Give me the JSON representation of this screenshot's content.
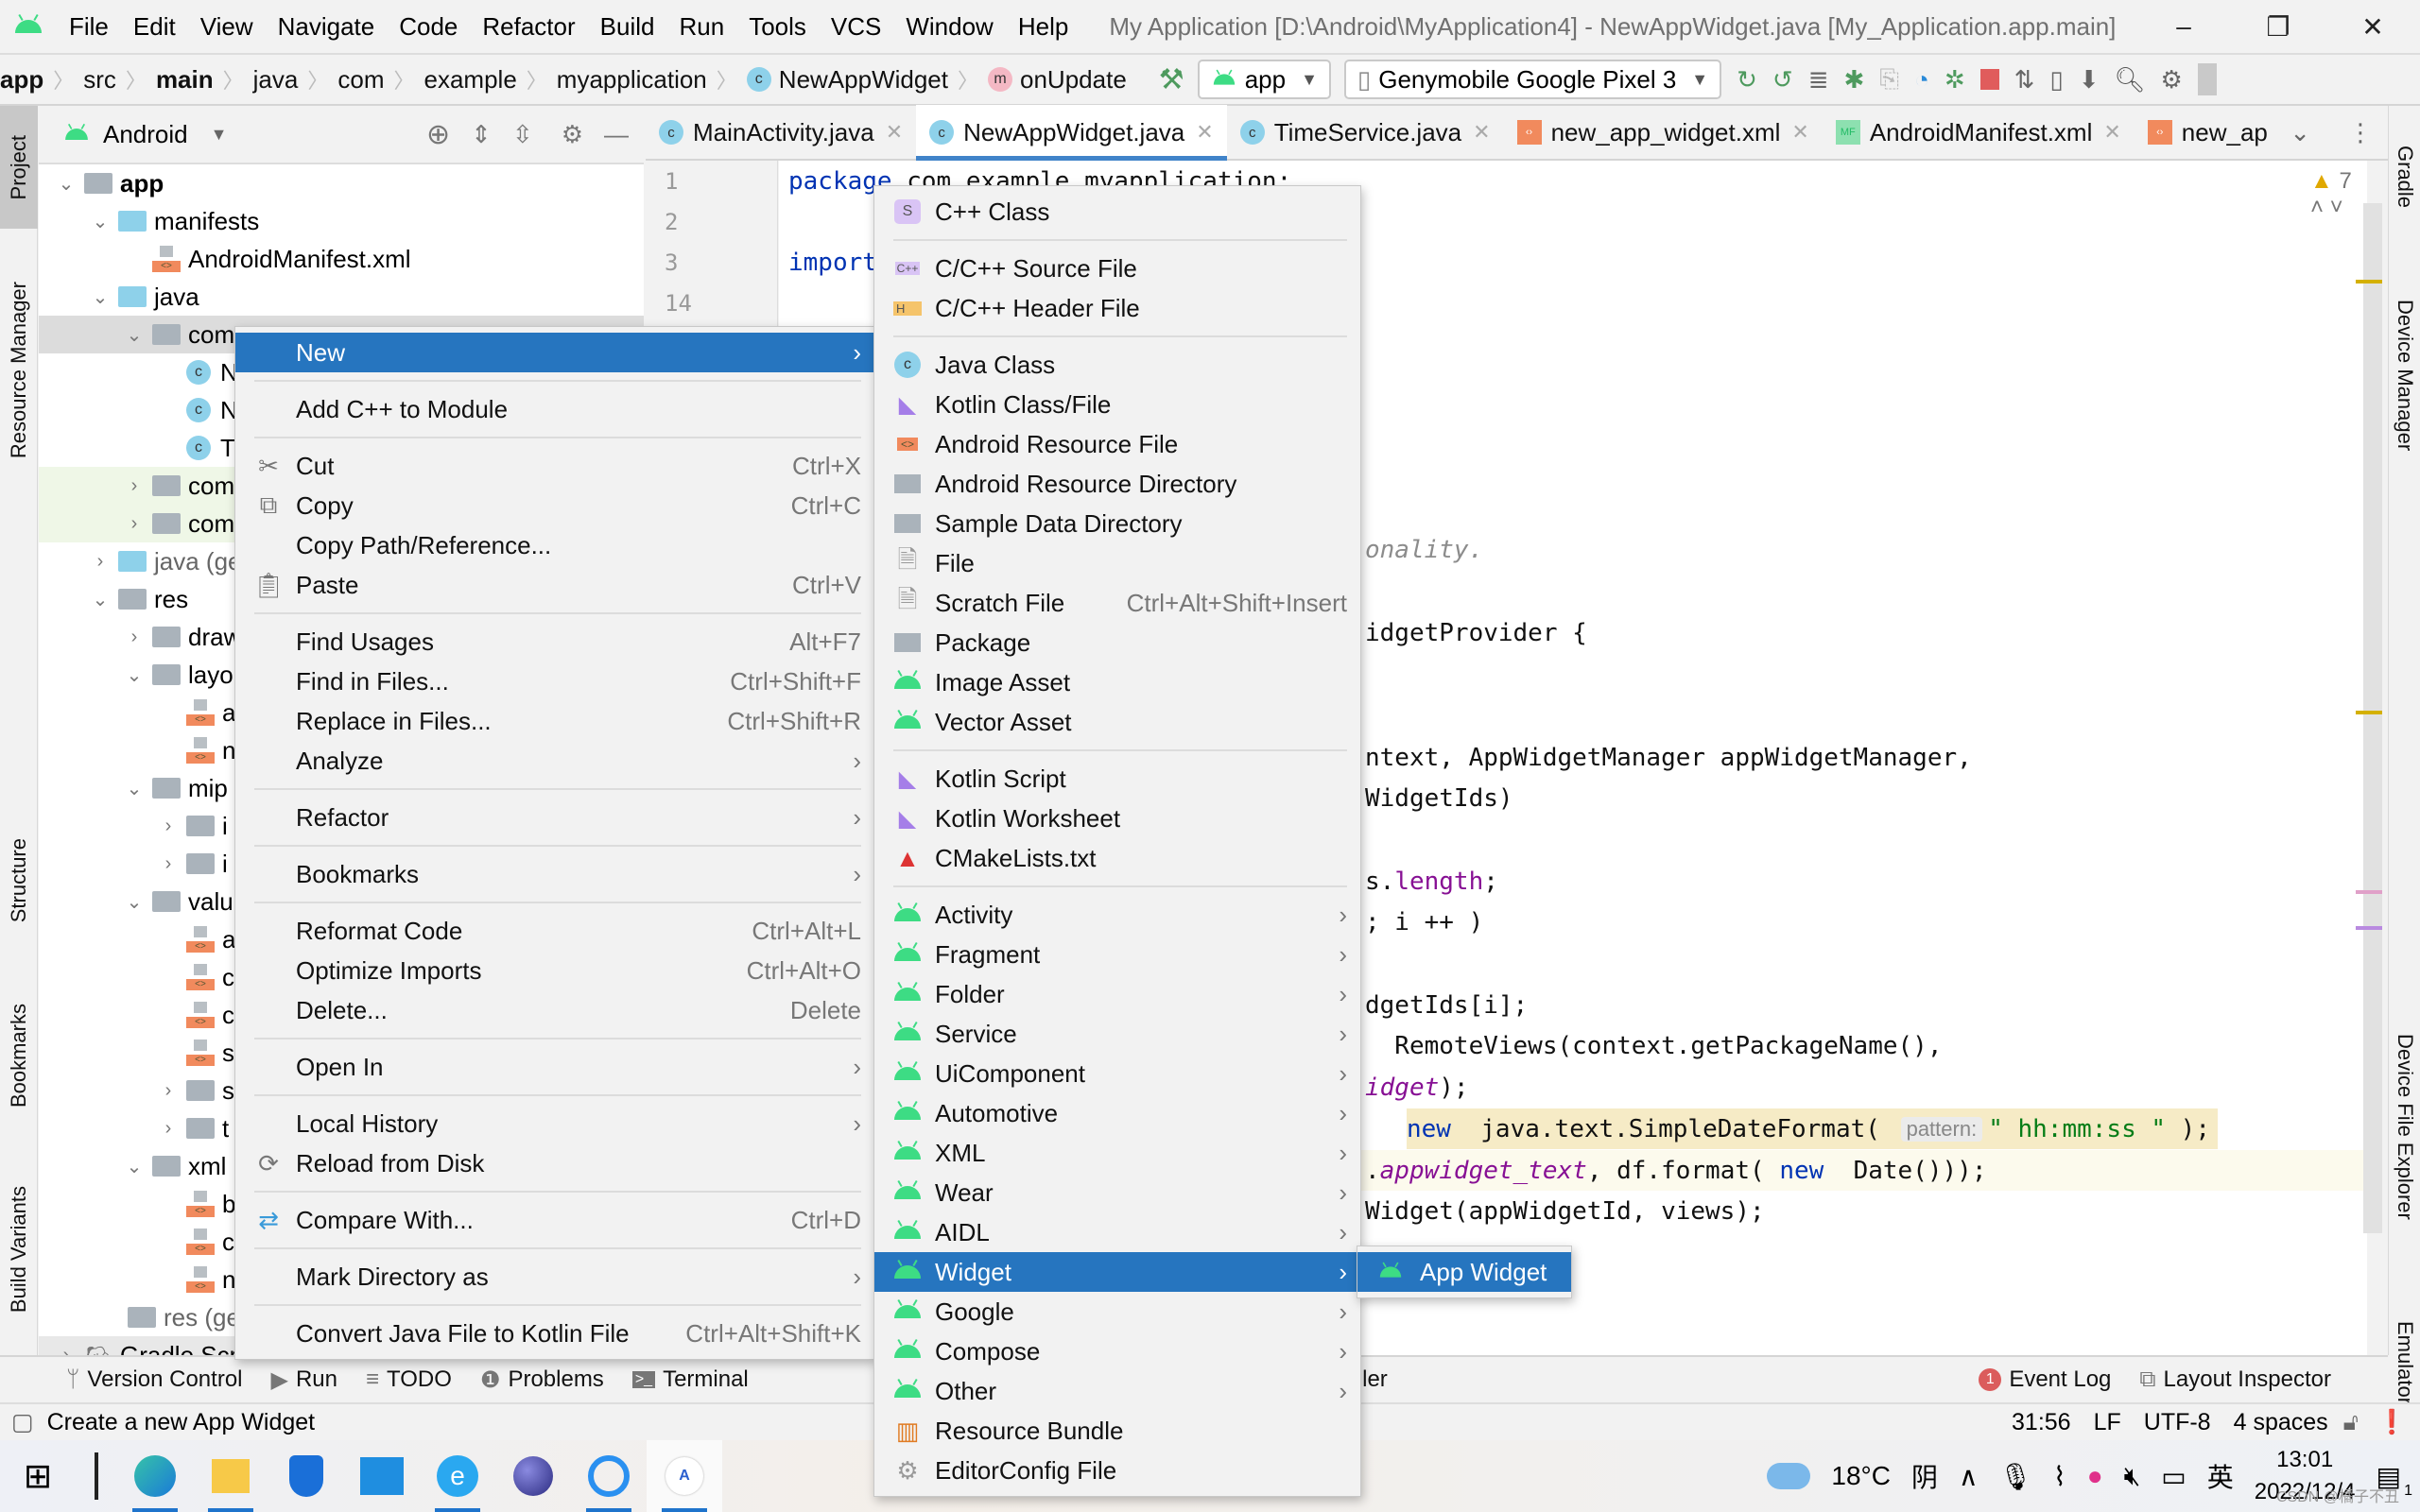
{
  "menubar": {
    "items": [
      "File",
      "Edit",
      "View",
      "Navigate",
      "Code",
      "Refactor",
      "Build",
      "Run",
      "Tools",
      "VCS",
      "Window",
      "Help"
    ],
    "title": "My Application [D:\\Android\\MyApplication4] - NewAppWidget.java [My_Application.app.main]",
    "minimize": "–",
    "restore": "❐",
    "close": "✕"
  },
  "breadcrumb": {
    "items": [
      "app",
      "src",
      "main",
      "java",
      "com",
      "example",
      "myapplication",
      "NewAppWidget",
      "onUpdate"
    ],
    "class_badge": "c",
    "method_badge": "m"
  },
  "toolbar": {
    "run_config": "app",
    "device": "Genymobile Google Pixel 3"
  },
  "left_tool_tabs": [
    "Project",
    "Resource Manager",
    "Structure",
    "Bookmarks",
    "Build Variants"
  ],
  "right_tool_tabs": [
    "Gradle",
    "Device Manager",
    "Device File Explorer",
    "Emulator"
  ],
  "project": {
    "view_selector": "Android",
    "tree": [
      {
        "label": "app",
        "bold": true
      },
      {
        "label": "manifests"
      },
      {
        "label": "AndroidManifest.xml"
      },
      {
        "label": "java"
      },
      {
        "label": "com"
      },
      {
        "label": "N"
      },
      {
        "label": "N"
      },
      {
        "label": "T"
      },
      {
        "label": "com"
      },
      {
        "label": "com"
      },
      {
        "label": "java (ge"
      },
      {
        "label": "res"
      },
      {
        "label": "draw"
      },
      {
        "label": "layo"
      },
      {
        "label": "a"
      },
      {
        "label": "n"
      },
      {
        "label": "mip"
      },
      {
        "label": "i"
      },
      {
        "label": "i"
      },
      {
        "label": "valu"
      },
      {
        "label": "a"
      },
      {
        "label": "c"
      },
      {
        "label": "c"
      },
      {
        "label": "s"
      },
      {
        "label": "s"
      },
      {
        "label": "t"
      },
      {
        "label": "xml"
      },
      {
        "label": "b"
      },
      {
        "label": "c"
      },
      {
        "label": "n"
      },
      {
        "label": "res (ge"
      },
      {
        "label": "Gradle Scr"
      }
    ]
  },
  "editor": {
    "tabs": [
      {
        "label": "MainActivity.java",
        "icon": "c"
      },
      {
        "label": "NewAppWidget.java",
        "icon": "c",
        "active": true
      },
      {
        "label": "TimeService.java",
        "icon": "c"
      },
      {
        "label": "new_app_widget.xml",
        "icon": "xml"
      },
      {
        "label": "AndroidManifest.xml",
        "icon": "mf"
      },
      {
        "label": "new_ap",
        "icon": "xml"
      }
    ],
    "warnings_count": "7",
    "line_numbers": [
      "1",
      "2",
      "3",
      "14"
    ],
    "code": {
      "l1_kw": "package",
      "l1_rest": " com.example.myapplication;",
      "l3_kw": "import",
      "comment": "onality.",
      "provider": "idgetProvider {",
      "params1": "ntext, AppWidgetManager appWidgetManager,",
      "params2": "WidgetIds)",
      "len_a": "s.",
      "len_b": "length",
      "len_c": ";",
      "loop": "; i ++ )",
      "ids": "dgetIds[i];",
      "remote": "  RemoteViews(context.getPackageName(),",
      "widget_a": "idget",
      "widget_b": ");",
      "sdf_new": "new",
      "sdf_mid": "  java.text.SimpleDateFormat( ",
      "sdf_hint": "pattern:",
      "sdf_str": "\" hh:mm:ss \"",
      "sdf_end": " );",
      "set_a": ".",
      "set_b": "appwidget_text",
      "set_c": ", df.format( ",
      "set_new": "new",
      "set_d": "  Date()));",
      "update": "Widget(appWidgetId, views);"
    }
  },
  "context_menu": {
    "groups": [
      [
        {
          "label": "New",
          "submenu": true,
          "highlighted": true
        }
      ],
      [
        {
          "label": "Add C++ to Module"
        }
      ],
      [
        {
          "label": "Cut",
          "shortcut": "Ctrl+X",
          "icon": "scissors"
        },
        {
          "label": "Copy",
          "shortcut": "Ctrl+C",
          "icon": "copy"
        },
        {
          "label": "Copy Path/Reference..."
        },
        {
          "label": "Paste",
          "shortcut": "Ctrl+V",
          "icon": "clipboard"
        }
      ],
      [
        {
          "label": "Find Usages",
          "shortcut": "Alt+F7"
        },
        {
          "label": "Find in Files...",
          "shortcut": "Ctrl+Shift+F"
        },
        {
          "label": "Replace in Files...",
          "shortcut": "Ctrl+Shift+R"
        },
        {
          "label": "Analyze",
          "submenu": true
        }
      ],
      [
        {
          "label": "Refactor",
          "submenu": true
        }
      ],
      [
        {
          "label": "Bookmarks",
          "submenu": true
        }
      ],
      [
        {
          "label": "Reformat Code",
          "shortcut": "Ctrl+Alt+L"
        },
        {
          "label": "Optimize Imports",
          "shortcut": "Ctrl+Alt+O"
        },
        {
          "label": "Delete...",
          "shortcut": "Delete"
        }
      ],
      [
        {
          "label": "Open In",
          "submenu": true
        }
      ],
      [
        {
          "label": "Local History",
          "submenu": true
        },
        {
          "label": "Reload from Disk",
          "icon": "reload"
        }
      ],
      [
        {
          "label": "Compare With...",
          "shortcut": "Ctrl+D",
          "icon": "compare"
        }
      ],
      [
        {
          "label": "Mark Directory as",
          "submenu": true
        }
      ],
      [
        {
          "label": "Convert Java File to Kotlin File",
          "shortcut": "Ctrl+Alt+Shift+K"
        }
      ]
    ]
  },
  "new_submenu": {
    "groups": [
      [
        {
          "label": "C++ Class",
          "icon": "cpp-class"
        }
      ],
      [
        {
          "label": "C/C++ Source File",
          "icon": "cpp-source"
        },
        {
          "label": "C/C++ Header File",
          "icon": "cpp-header"
        }
      ],
      [
        {
          "label": "Java Class",
          "icon": "java-class"
        },
        {
          "label": "Kotlin Class/File",
          "icon": "kotlin"
        },
        {
          "label": "Android Resource File",
          "icon": "xml"
        },
        {
          "label": "Android Resource Directory",
          "icon": "folder"
        },
        {
          "label": "Sample Data Directory",
          "icon": "folder"
        },
        {
          "label": "File",
          "icon": "file"
        },
        {
          "label": "Scratch File",
          "shortcut": "Ctrl+Alt+Shift+Insert",
          "icon": "scratch"
        },
        {
          "label": "Package",
          "icon": "package"
        },
        {
          "label": "Image Asset",
          "icon": "android"
        },
        {
          "label": "Vector Asset",
          "icon": "android"
        }
      ],
      [
        {
          "label": "Kotlin Script",
          "icon": "kotlin"
        },
        {
          "label": "Kotlin Worksheet",
          "icon": "kotlin"
        },
        {
          "label": "CMakeLists.txt",
          "icon": "cmake"
        }
      ],
      [
        {
          "label": "Activity",
          "icon": "android",
          "submenu": true
        },
        {
          "label": "Fragment",
          "icon": "android",
          "submenu": true
        },
        {
          "label": "Folder",
          "icon": "android",
          "submenu": true
        },
        {
          "label": "Service",
          "icon": "android",
          "submenu": true
        },
        {
          "label": "UiComponent",
          "icon": "android",
          "submenu": true
        },
        {
          "label": "Automotive",
          "icon": "android",
          "submenu": true
        },
        {
          "label": "XML",
          "icon": "android",
          "submenu": true
        },
        {
          "label": "Wear",
          "icon": "android",
          "submenu": true
        },
        {
          "label": "AIDL",
          "icon": "android",
          "submenu": true
        },
        {
          "label": "Widget",
          "icon": "android",
          "submenu": true,
          "highlighted": true
        },
        {
          "label": "Google",
          "icon": "android",
          "submenu": true
        },
        {
          "label": "Compose",
          "icon": "android",
          "submenu": true
        },
        {
          "label": "Other",
          "icon": "android",
          "submenu": true
        },
        {
          "label": "Resource Bundle",
          "icon": "bundle"
        },
        {
          "label": "EditorConfig File",
          "icon": "gear"
        }
      ]
    ]
  },
  "widget_submenu": {
    "items": [
      {
        "label": "App Widget",
        "highlighted": true
      }
    ]
  },
  "tool_windows": {
    "left": [
      "Version Control",
      "Run",
      "TODO",
      "Problems",
      "Terminal"
    ],
    "profiler": "Profiler",
    "event_log": "Event Log",
    "event_log_count": "1",
    "layout_inspector": "Layout Inspector"
  },
  "status_bar": {
    "message": "Create a new App Widget",
    "position": "31:56",
    "line_sep": "LF",
    "encoding": "UTF-8",
    "indent": "4 spaces"
  },
  "taskbar": {
    "battery": "100%",
    "weather_temp": "18°C",
    "weather_desc": "阴",
    "ime": "英",
    "time": "13:01",
    "date": "2022/12/4",
    "notification_count": "1",
    "watermark": "CSDN @橘子不丑"
  },
  "colors": {
    "accent": "#2675bf",
    "android_green": "#3ddc84",
    "keyword": "#0033b3",
    "field": "#871094",
    "string": "#067d17"
  }
}
